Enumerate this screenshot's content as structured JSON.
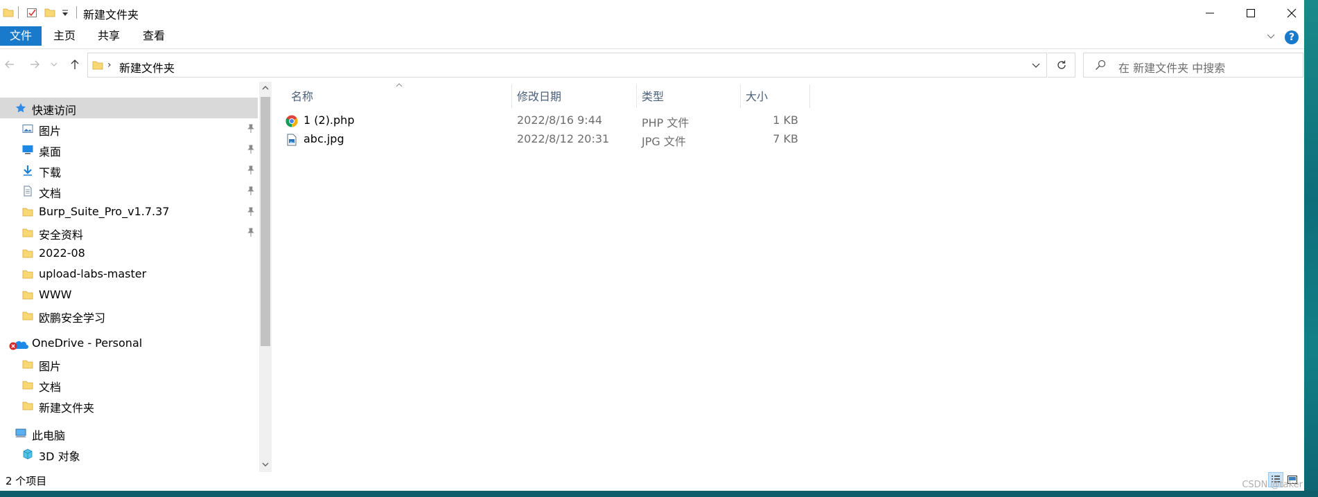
{
  "window": {
    "title": "新建文件夹",
    "controls": {
      "minimize": "minimize",
      "maximize": "maximize",
      "close": "close"
    }
  },
  "ribbon": {
    "tabs": [
      {
        "label": "文件",
        "active": true
      },
      {
        "label": "主页"
      },
      {
        "label": "共享"
      },
      {
        "label": "查看"
      }
    ],
    "help": "?"
  },
  "address": {
    "path": "新建文件夹",
    "search_placeholder": "在 新建文件夹 中搜索"
  },
  "nav_pane": {
    "quick_access": "快速访问",
    "items": [
      {
        "label": "图片",
        "icon": "pictures-icon",
        "pinned": true
      },
      {
        "label": "桌面",
        "icon": "desktop-icon",
        "pinned": true
      },
      {
        "label": "下载",
        "icon": "download-icon",
        "pinned": true
      },
      {
        "label": "文档",
        "icon": "documents-icon",
        "pinned": true
      },
      {
        "label": "Burp_Suite_Pro_v1.7.37",
        "icon": "folder-icon",
        "pinned": true
      },
      {
        "label": "安全资料",
        "icon": "folder-icon",
        "pinned": true
      },
      {
        "label": "2022-08",
        "icon": "folder-icon"
      },
      {
        "label": "upload-labs-master",
        "icon": "folder-icon"
      },
      {
        "label": "WWW",
        "icon": "folder-icon"
      },
      {
        "label": "欧鹏安全学习",
        "icon": "folder-icon"
      }
    ],
    "onedrive": "OneDrive - Personal",
    "onedrive_items": [
      {
        "label": "图片"
      },
      {
        "label": "文档"
      },
      {
        "label": "新建文件夹"
      }
    ],
    "this_pc": "此电脑",
    "pc_items": [
      {
        "label": "3D 对象"
      }
    ]
  },
  "file_list": {
    "columns": [
      "名称",
      "修改日期",
      "类型",
      "大小"
    ],
    "rows": [
      {
        "name": "1 (2).php",
        "date": "2022/8/16 9:44",
        "type": "PHP 文件",
        "size": "1 KB",
        "icon": "chrome-icon"
      },
      {
        "name": "abc.jpg",
        "date": "2022/8/12 20:31",
        "type": "JPG 文件",
        "size": "7 KB",
        "icon": "image-file-icon"
      }
    ]
  },
  "status": {
    "item_count": "2 个项目"
  },
  "watermark": "CSDN @taker",
  "colors": {
    "accent": "#1979ca",
    "selected_nav": "#d9d9d9",
    "header_text": "#4c607a",
    "folder_yellow": "#f8d775"
  }
}
